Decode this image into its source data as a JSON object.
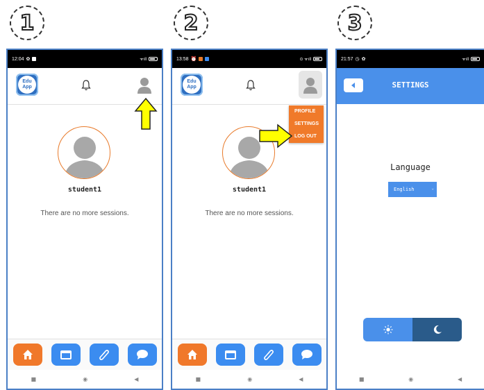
{
  "steps": [
    "1",
    "2",
    "3"
  ],
  "screen1": {
    "status_time": "12:04",
    "logo_top": "Edu",
    "logo_bottom": "App",
    "username": "student1",
    "sessions_text": "There are no more sessions."
  },
  "screen2": {
    "status_time": "13:58",
    "logo_top": "Edu",
    "logo_bottom": "App",
    "username": "student1",
    "sessions_text": "There are no more sessions.",
    "menu": [
      "PROFILE",
      "SETTINGS",
      "LOG OUT"
    ]
  },
  "screen3": {
    "status_time": "21:57",
    "title": "SETTINGS",
    "language_label": "Language",
    "language_value": "English"
  },
  "icons": {
    "bell": "bell-icon",
    "profile": "user-icon",
    "home": "home-icon",
    "calendar": "calendar-icon",
    "attachment": "paperclip-icon",
    "chat": "chat-icon",
    "sun": "sun-icon",
    "moon": "moon-icon",
    "back": "back-arrow-icon"
  },
  "colors": {
    "accent_blue": "#3b8cf0",
    "accent_orange": "#f0782a",
    "highlight_arrow": "#ffff00"
  }
}
